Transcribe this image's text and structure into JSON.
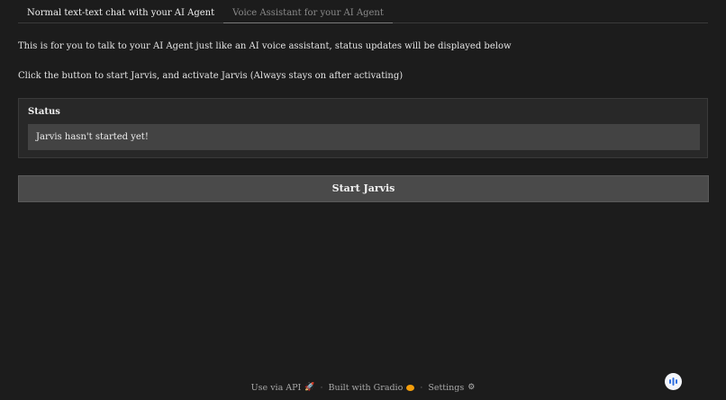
{
  "tabs": [
    {
      "label": "Normal text-text chat with your AI Agent",
      "active": true
    },
    {
      "label": "Voice Assistant for your AI Agent",
      "active": false
    }
  ],
  "content": {
    "intro": "This is for you to talk to your AI Agent just like an AI voice assistant, status updates will be displayed below",
    "instruction": "Click the button to start Jarvis, and activate Jarvis (Always stays on after activating)"
  },
  "status": {
    "label": "Status",
    "value": "Jarvis hasn't started yet!"
  },
  "start_button": {
    "label": "Start Jarvis"
  },
  "footer": {
    "api": "Use via API",
    "sep": "·",
    "built": "Built with Gradio",
    "settings": "Settings"
  },
  "icons": {
    "api": "rocket-icon",
    "gradio": "gradio-logo-icon",
    "settings": "gear-icon",
    "voice": "voice-bars-icon"
  },
  "colors": {
    "background": "#1c1c1c",
    "panel": "#282828",
    "field": "#434343",
    "button": "#4a4a4a",
    "voice_fab": "#f4f6fb",
    "voice_fab_icon": "#2f6fdf"
  }
}
